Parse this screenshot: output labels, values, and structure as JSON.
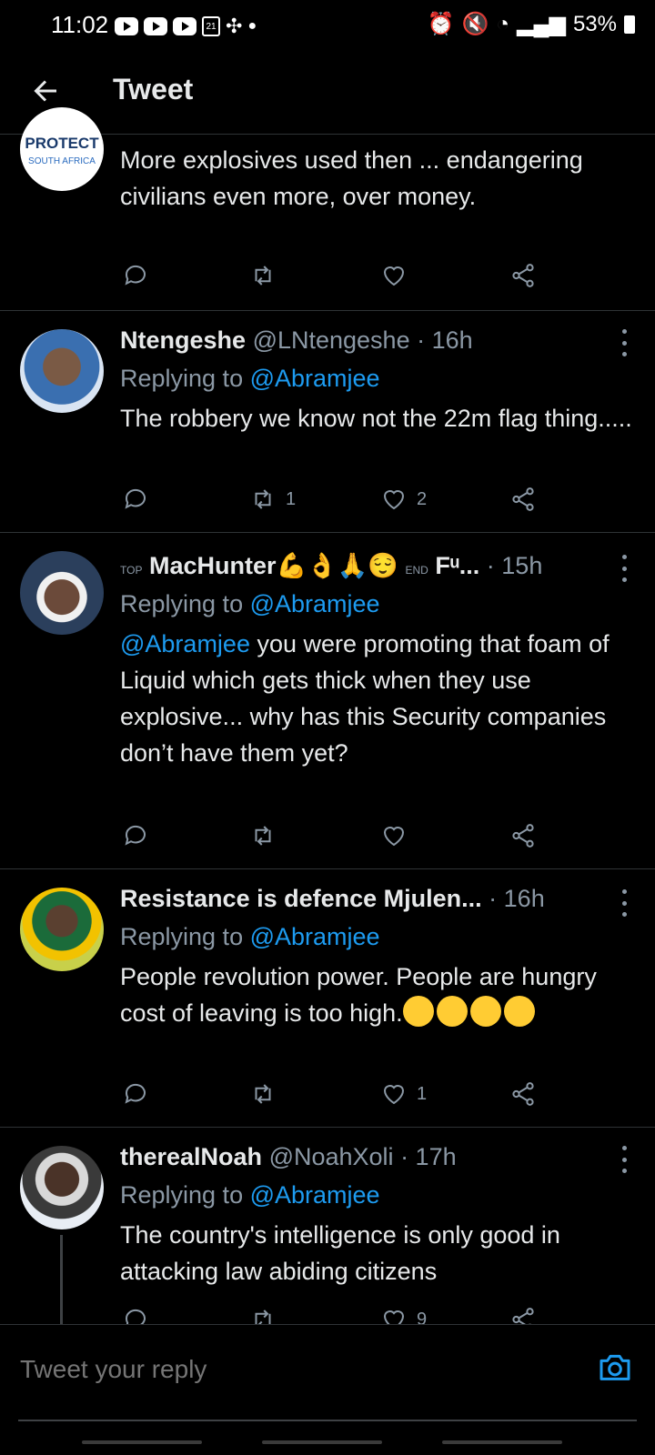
{
  "status_bar": {
    "time": "11:02",
    "calendar_day": "21",
    "battery": "53%"
  },
  "header": {
    "title": "Tweet"
  },
  "tweets": [
    {
      "avatar_label_top": "PROTECT",
      "avatar_label_bottom": "SOUTH AFRICA",
      "text": "More explosives used then ... endangering civilians even more, over money."
    },
    {
      "name": "Ntengeshe",
      "handle": "@LNtengeshe",
      "time": "· 16h",
      "replying_prefix": "Replying to",
      "replying_to": "@Abramjee",
      "text": "The robbery we know not the 22m flag thing.....",
      "retweets": "1",
      "likes": "2"
    },
    {
      "name_prefix": "TOP",
      "name": "MacHunter💪👌🙏😌",
      "name_suffix_label": "END",
      "name_tail": "Fᵘ...",
      "time": "· 15h",
      "replying_prefix": "Replying to",
      "replying_to": "@Abramjee",
      "text_mention": "@Abramjee",
      "text": " you were promoting that foam of Liquid which gets thick when they use explosive... why has this Security companies don’t have them yet?"
    },
    {
      "name": "Resistance is defence Mjulen...",
      "time": "· 16h",
      "replying_prefix": "Replying to",
      "replying_to": "@Abramjee",
      "text": "People revolution power. People are hungry cost of leaving is too high.",
      "likes": "1"
    },
    {
      "name": "therealNoah",
      "handle": "@NoahXoli",
      "time": "· 17h",
      "replying_prefix": "Replying to",
      "replying_to": "@Abramjee",
      "text": "The country's intelligence is only good in attacking law abiding citizens",
      "likes": "9"
    }
  ],
  "reply_bar": {
    "placeholder": "Tweet your reply"
  },
  "colors": {
    "accent": "#1d9bf0",
    "muted": "#8b98a5",
    "text": "#e7e9ea",
    "divider": "#2f3336"
  }
}
